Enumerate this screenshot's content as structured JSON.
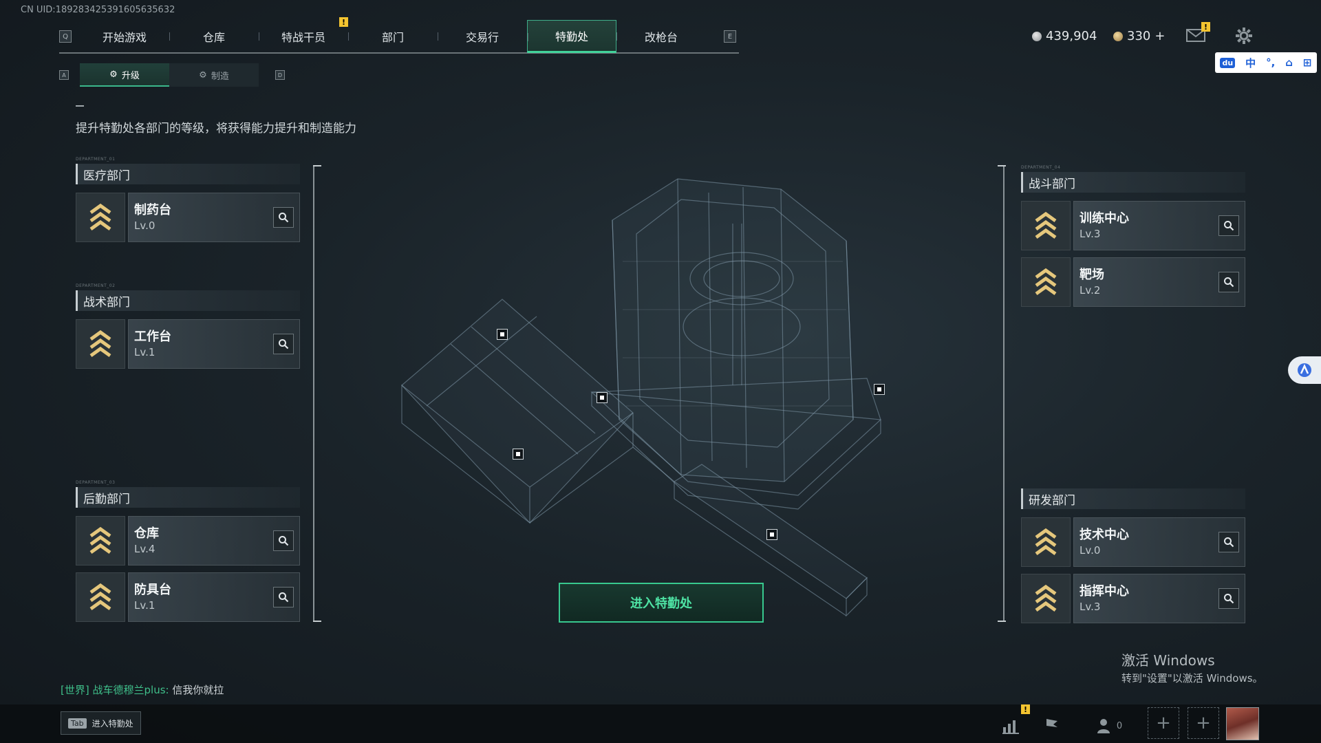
{
  "uid": "CN UID:18928342539160563563​2",
  "nav": {
    "left_key": "Q",
    "right_key": "E",
    "tabs": [
      {
        "label": "开始游戏"
      },
      {
        "label": "仓库"
      },
      {
        "label": "特战干员"
      },
      {
        "label": "部门"
      },
      {
        "label": "交易行"
      },
      {
        "label": "特勤处"
      },
      {
        "label": "改枪台"
      }
    ],
    "active": "特勤处"
  },
  "currency": {
    "silver": "439,904",
    "gold": "330"
  },
  "ime": {
    "mode_label": "中"
  },
  "subtabs": {
    "left_key": "A",
    "right_key": "D",
    "upgrade": "升级",
    "craft": "制造"
  },
  "description": "提升特勤处各部门的等级，将获得能力提升和制造能力",
  "departments": {
    "medical": {
      "tag": "DEPARTMENT_01",
      "title": "医疗部门",
      "facilities": [
        {
          "name": "制药台",
          "level": "Lv.0"
        }
      ]
    },
    "tactical": {
      "tag": "DEPARTMENT_02",
      "title": "战术部门",
      "facilities": [
        {
          "name": "工作台",
          "level": "Lv.1"
        }
      ]
    },
    "logistics": {
      "tag": "DEPARTMENT_03",
      "title": "后勤部门",
      "facilities": [
        {
          "name": "仓库",
          "level": "Lv.4"
        },
        {
          "name": "防具台",
          "level": "Lv.1"
        }
      ]
    },
    "combat": {
      "tag": "DEPARTMENT_04",
      "title": "战斗部门",
      "facilities": [
        {
          "name": "训练中心",
          "level": "Lv.3"
        },
        {
          "name": "靶场",
          "level": "Lv.2"
        }
      ]
    },
    "research": {
      "title": "研发部门",
      "facilities": [
        {
          "name": "技术中心",
          "level": "Lv.0"
        },
        {
          "name": "指挥中心",
          "level": "Lv.3"
        }
      ]
    }
  },
  "enter_button": "进入特勤处",
  "chat": {
    "channel": "[世界]",
    "sender": "战车德穆兰plus:",
    "message": "信我你就拉"
  },
  "tab_hint": {
    "key": "Tab",
    "label": "进入特勤处"
  },
  "social": {
    "friends_count": "0"
  },
  "windows_activation": {
    "line1": "激活 Windows",
    "line2": "转到\"设置\"以激活 Windows。"
  },
  "colors": {
    "accent": "#41d39a",
    "warning": "#f4c430",
    "chevron": "#e5c77c"
  }
}
